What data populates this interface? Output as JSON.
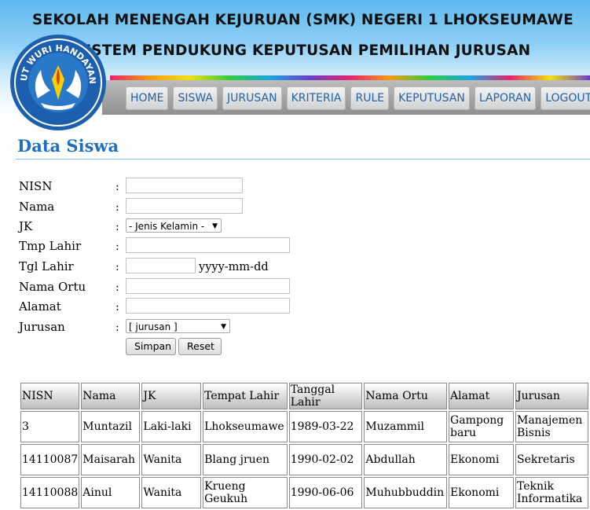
{
  "header": {
    "title": "SEKOLAH MENENGAH KEJURUAN (SMK) NEGERI 1 LHOKSEUMAWE",
    "subtitle": "SISTEM PENDUKUNG KEPUTUSAN PEMILIHAN JURUSAN",
    "logo_text": "TUT WURI HANDAYANI"
  },
  "nav": [
    "HOME",
    "SISWA",
    "JURUSAN",
    "KRITERIA",
    "RULE",
    "KEPUTUSAN",
    "LAPORAN",
    "LOGOUT"
  ],
  "page_title": "Data Siswa",
  "form": {
    "colon": ":",
    "nisn_label": "NISN",
    "nama_label": "Nama",
    "jk_label": "JK",
    "jk_selected": "- Jenis Kelamin -",
    "tmp_lahir_label": "Tmp Lahir",
    "tgl_lahir_label": "Tgl Lahir",
    "tgl_lahir_hint": "yyyy-mm-dd",
    "nama_ortu_label": "Nama Ortu",
    "alamat_label": "Alamat",
    "jurusan_label": "Jurusan",
    "jurusan_selected": "[ jurusan ]",
    "submit_label": "Simpan",
    "reset_label": "Reset"
  },
  "table": {
    "headers": [
      "NISN",
      "Nama",
      "JK",
      "Tempat Lahir",
      "Tanggal Lahir",
      "Nama Ortu",
      "Alamat",
      "Jurusan"
    ],
    "rows": [
      [
        "3",
        "Muntazil",
        "Laki-laki",
        "Lhokseumawe",
        "1989-03-22",
        "Muzammil",
        "Gampong baru",
        "Manajemen Bisnis"
      ],
      [
        "14110087",
        "Maisarah",
        "Wanita",
        "Blang jruen",
        "1990-02-02",
        "Abdullah",
        "Ekonomi",
        "Sekretaris"
      ],
      [
        "14110088",
        "Ainul",
        "Wanita",
        "Krueng Geukuh",
        "1990-06-06",
        "Muhubbuddin",
        "Ekonomi",
        "Teknik Informatika"
      ]
    ]
  },
  "colors": {
    "nav_text": "#2163a8",
    "page_title": "#1e6fc0",
    "header_top": "#5cb8ee"
  }
}
